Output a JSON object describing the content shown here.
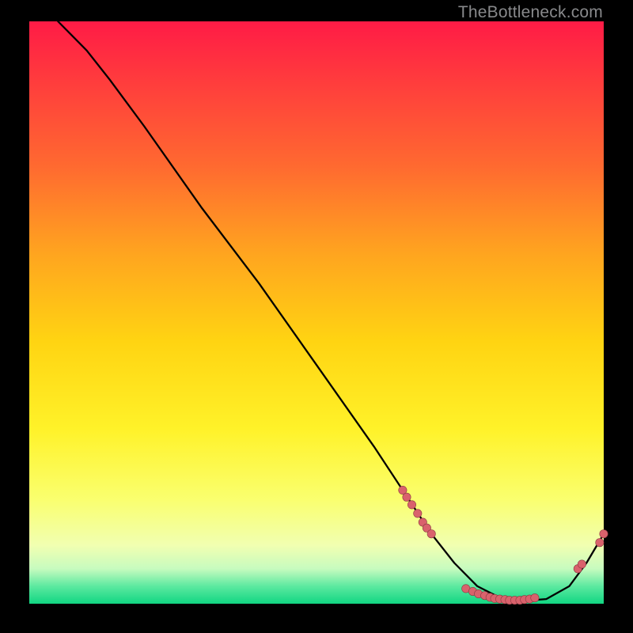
{
  "watermark": "TheBottleneck.com",
  "colors": {
    "curve": "#000000",
    "marker_fill": "#d9626c",
    "marker_stroke": "#8c3a42"
  },
  "chart_data": {
    "type": "line",
    "title": "",
    "xlabel": "",
    "ylabel": "",
    "xlim": [
      0,
      100
    ],
    "ylim": [
      0,
      100
    ],
    "curve": {
      "x": [
        5,
        7,
        10,
        14,
        20,
        30,
        40,
        50,
        60,
        66,
        70,
        74,
        78,
        82,
        86,
        90,
        94,
        97,
        100
      ],
      "y": [
        100,
        98,
        95,
        90,
        82,
        68,
        55,
        41,
        27,
        18,
        12,
        7,
        3,
        1,
        0.5,
        0.8,
        3,
        7,
        12
      ]
    },
    "series": [
      {
        "name": "left-cluster",
        "x": [
          65.0,
          65.7,
          66.6,
          67.6,
          68.5,
          69.2,
          70.0
        ],
        "y": [
          19.5,
          18.3,
          17.0,
          15.5,
          14.0,
          13.0,
          12.0
        ]
      },
      {
        "name": "bottom-cluster",
        "x": [
          76.0,
          77.2,
          78.2,
          79.3,
          80.2,
          81.0,
          81.9,
          82.8,
          83.6,
          84.5,
          85.4,
          86.2,
          87.1,
          88.0
        ],
        "y": [
          2.6,
          2.1,
          1.7,
          1.4,
          1.1,
          0.9,
          0.8,
          0.7,
          0.6,
          0.6,
          0.6,
          0.7,
          0.8,
          1.0
        ]
      },
      {
        "name": "right-cluster",
        "x": [
          95.5,
          96.2,
          99.3,
          100.0
        ],
        "y": [
          6.0,
          6.8,
          10.5,
          12.0
        ]
      }
    ]
  }
}
